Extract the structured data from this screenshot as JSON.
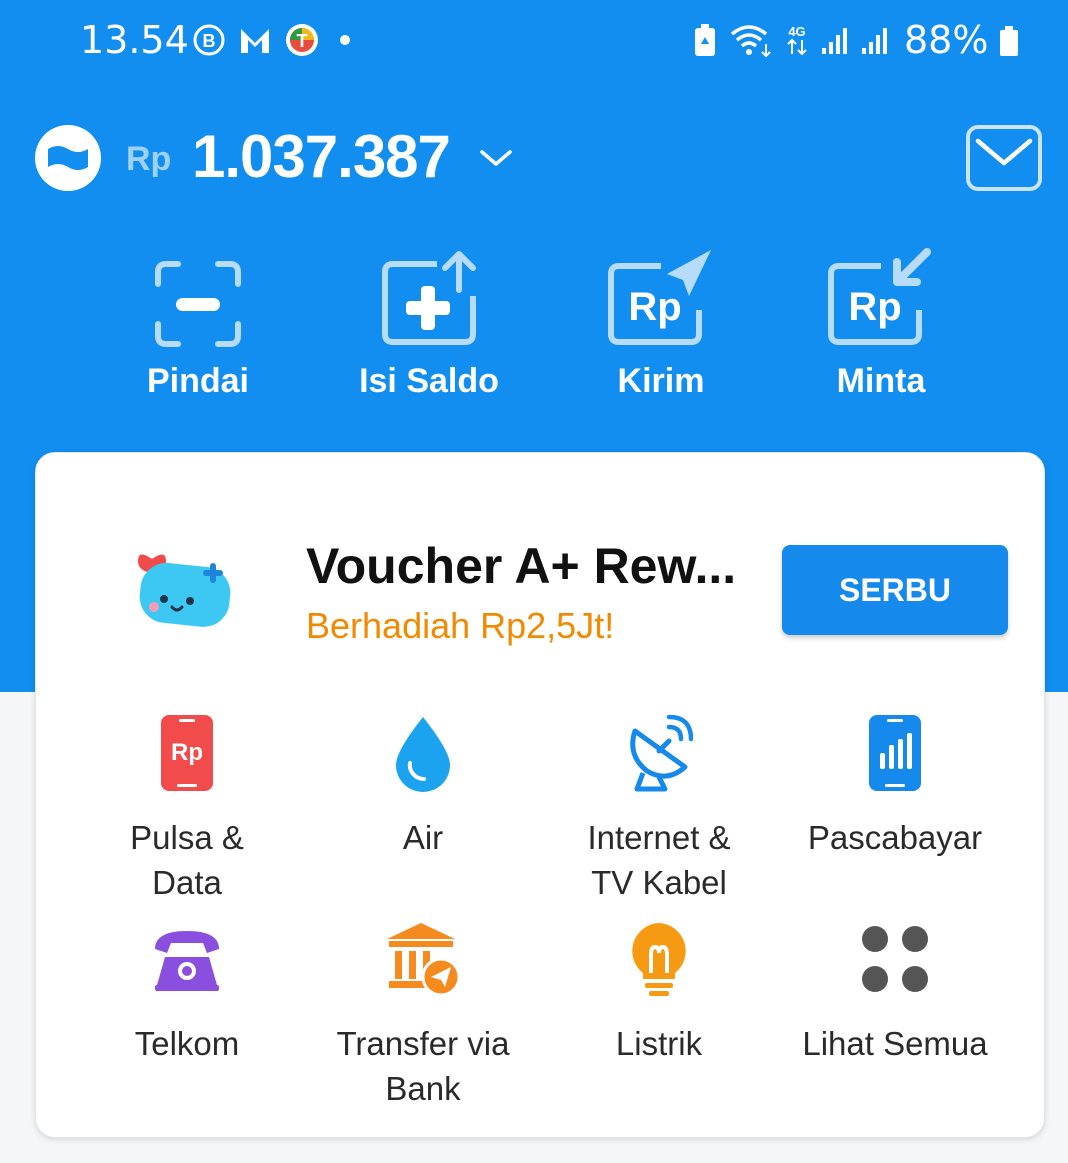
{
  "status_bar": {
    "time": "13.54",
    "battery": "88%",
    "network": "4G"
  },
  "header": {
    "currency": "Rp",
    "balance": "1.037.387"
  },
  "actions": [
    {
      "label": "Pindai",
      "icon": "scan-icon"
    },
    {
      "label": "Isi Saldo",
      "icon": "top-up-icon"
    },
    {
      "label": "Kirim",
      "icon": "send-money-icon"
    },
    {
      "label": "Minta",
      "icon": "request-money-icon"
    }
  ],
  "promo": {
    "title": "Voucher A+ Rew...",
    "subtitle": "Berhadiah Rp2,5Jt!",
    "button": "SERBU"
  },
  "services": [
    {
      "label": "Pulsa &\nData",
      "icon": "phone-credit-icon",
      "color": "#f24b4b"
    },
    {
      "label": "Air",
      "icon": "water-drop-icon",
      "color": "#1ca3f0"
    },
    {
      "label": "Internet &\nTV Kabel",
      "icon": "satellite-dish-icon",
      "color": "#1589ec"
    },
    {
      "label": "Pascabayar",
      "icon": "postpaid-phone-icon",
      "color": "#1589ec"
    },
    {
      "label": "Telkom",
      "icon": "telephone-icon",
      "color": "#8b4fe0"
    },
    {
      "label": "Transfer via\nBank",
      "icon": "bank-transfer-icon",
      "color": "#f58a1f"
    },
    {
      "label": "Listrik",
      "icon": "lightbulb-icon",
      "color": "#f59a12"
    },
    {
      "label": "Lihat Semua",
      "icon": "more-grid-icon",
      "color": "#555555"
    }
  ],
  "colors": {
    "primary": "#118ef0",
    "accent_orange": "#f08a00",
    "button_blue": "#1589ec"
  }
}
